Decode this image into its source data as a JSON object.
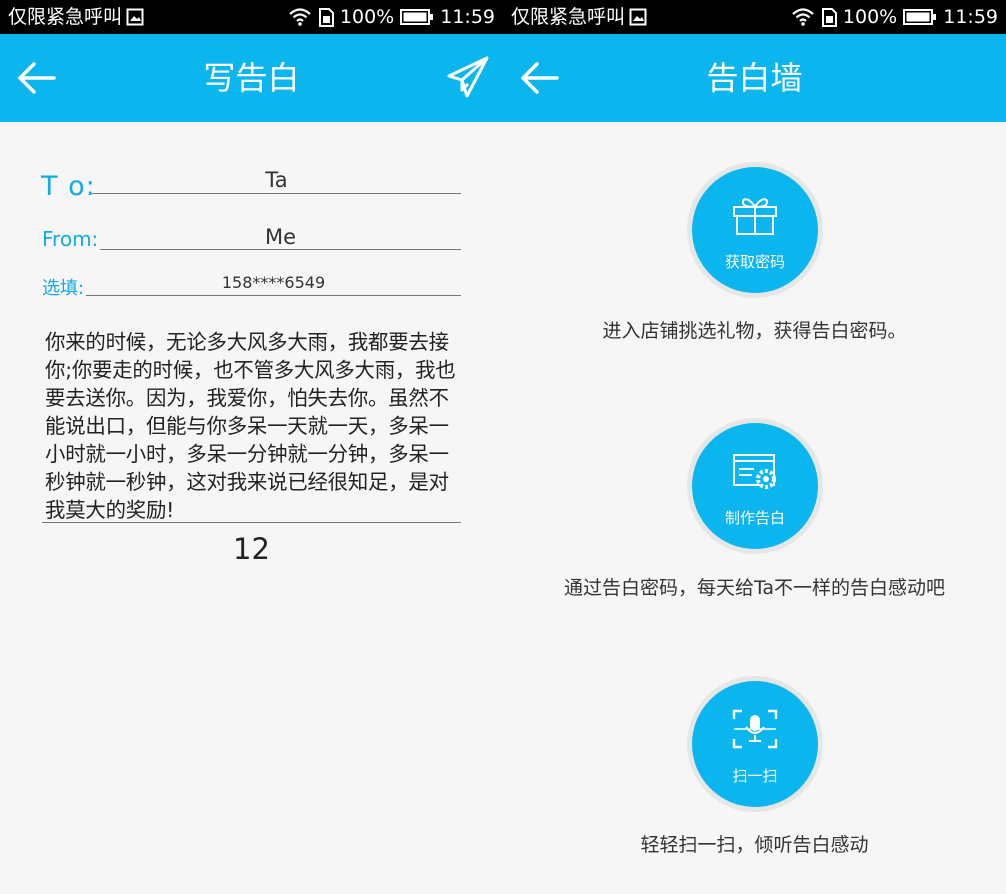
{
  "status_bar": {
    "carrier": "仅限紧急呼叫",
    "battery": "100%",
    "time": "11:59",
    "icons": [
      "image-icon",
      "wifi-icon",
      "sim-icon",
      "battery-icon"
    ]
  },
  "write_screen": {
    "title": "写告白",
    "icons": {
      "back": "back-arrow-icon",
      "send": "paper-plane-icon"
    },
    "to_label": "T o:",
    "to_value": "Ta",
    "from_label": "From:",
    "from_value": "Me",
    "optional_label": "选填:",
    "optional_value": "158****6549",
    "message": "你来的时候，无论多大风多大雨，我都要去接你;你要走的时候，也不管多大风多大雨，我也要去送你。因为，我爱你，怕失去你。虽然不能说出口，但能与你多呆一天就一天，多呆一小时就一小时，多呆一分钟就一分钟，多呆一秒钟就一秒钟，这对我来说已经很知足，是对我莫大的奖励!",
    "char_count": "12"
  },
  "wall_screen": {
    "title": "告白墙",
    "items": [
      {
        "label": "获取密码",
        "desc": "进入店铺挑选礼物，获得告白密码。",
        "icon": "gift-icon"
      },
      {
        "label": "制作告白",
        "desc": "通过告白密码，每天给Ta不一样的告白感动吧",
        "icon": "settings-card-icon"
      },
      {
        "label": "扫一扫",
        "desc": "轻轻扫一扫，倾听告白感动",
        "icon": "scan-mic-icon"
      }
    ]
  },
  "colors": {
    "accent": "#0bb5ee",
    "label_blue": "#13abe5",
    "status_bg": "#000000",
    "bg": "#f6f6f6"
  }
}
